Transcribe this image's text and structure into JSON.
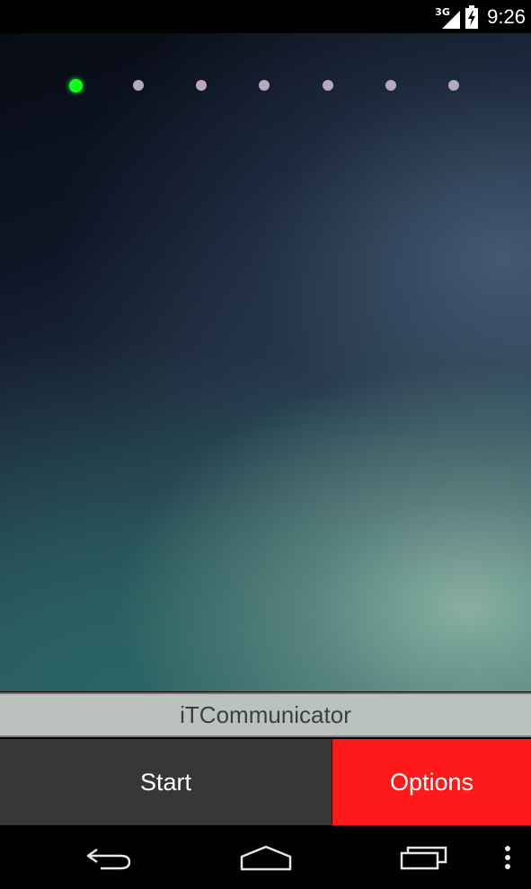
{
  "status_bar": {
    "network_type": "3G",
    "time": "9:26",
    "icons": [
      "signal-icon",
      "battery-charging-icon"
    ]
  },
  "wallpaper": {
    "page_indicator": {
      "count": 7,
      "active_index": 0,
      "active_color": "#12ff1a",
      "inactive_color": "#b7a8bc"
    }
  },
  "app": {
    "title": "iTCommunicator"
  },
  "buttons": {
    "start_label": "Start",
    "options_label": "Options",
    "start_color": "#373737",
    "options_color": "#fe1a1a"
  },
  "nav_bar": {
    "icons": [
      "back-icon",
      "home-icon",
      "recent-apps-icon",
      "overflow-menu-icon"
    ]
  }
}
